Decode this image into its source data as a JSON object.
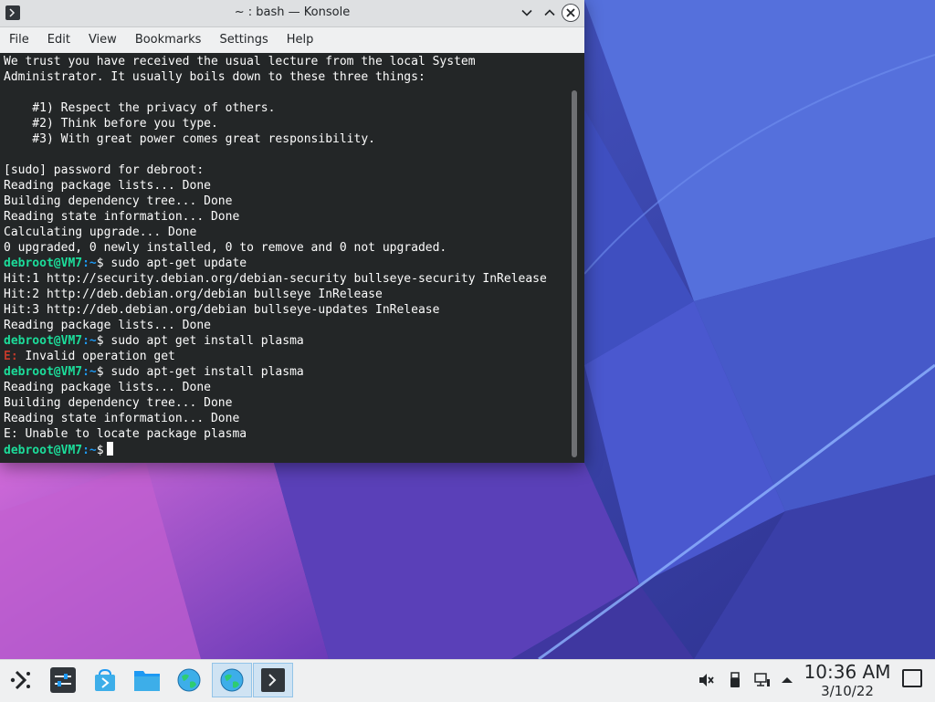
{
  "window": {
    "title": "~ : bash — Konsole",
    "menu": [
      "File",
      "Edit",
      "View",
      "Bookmarks",
      "Settings",
      "Help"
    ]
  },
  "terminal": {
    "lines": [
      {
        "type": "text",
        "text": "We trust you have received the usual lecture from the local System"
      },
      {
        "type": "text",
        "text": "Administrator. It usually boils down to these three things:"
      },
      {
        "type": "text",
        "text": ""
      },
      {
        "type": "text",
        "text": "    #1) Respect the privacy of others."
      },
      {
        "type": "text",
        "text": "    #2) Think before you type."
      },
      {
        "type": "text",
        "text": "    #3) With great power comes great responsibility."
      },
      {
        "type": "text",
        "text": ""
      },
      {
        "type": "text",
        "text": "[sudo] password for debroot:"
      },
      {
        "type": "text",
        "text": "Reading package lists... Done"
      },
      {
        "type": "text",
        "text": "Building dependency tree... Done"
      },
      {
        "type": "text",
        "text": "Reading state information... Done"
      },
      {
        "type": "text",
        "text": "Calculating upgrade... Done"
      },
      {
        "type": "text",
        "text": "0 upgraded, 0 newly installed, 0 to remove and 0 not upgraded."
      },
      {
        "type": "prompt",
        "user": "debroot@VM7",
        "sep": ":",
        "path": "~",
        "sign": "$",
        "command": " sudo apt-get update"
      },
      {
        "type": "text",
        "text": "Hit:1 http://security.debian.org/debian-security bullseye-security InRelease"
      },
      {
        "type": "text",
        "text": "Hit:2 http://deb.debian.org/debian bullseye InRelease"
      },
      {
        "type": "text",
        "text": "Hit:3 http://deb.debian.org/debian bullseye-updates InRelease"
      },
      {
        "type": "text",
        "text": "Reading package lists... Done"
      },
      {
        "type": "prompt",
        "user": "debroot@VM7",
        "sep": ":",
        "path": "~",
        "sign": "$",
        "command": " sudo apt get install plasma"
      },
      {
        "type": "error",
        "tag": "E:",
        "text": " Invalid operation get"
      },
      {
        "type": "prompt",
        "user": "debroot@VM7",
        "sep": ":",
        "path": "~",
        "sign": "$",
        "command": " sudo apt-get install plasma"
      },
      {
        "type": "text",
        "text": "Reading package lists... Done"
      },
      {
        "type": "text",
        "text": "Building dependency tree... Done"
      },
      {
        "type": "text",
        "text": "Reading state information... Done"
      },
      {
        "type": "text",
        "text": "E: Unable to locate package plasma"
      },
      {
        "type": "prompt",
        "user": "debroot@VM7",
        "sep": ":",
        "path": "~",
        "sign": "$",
        "command": "",
        "cursor": true
      }
    ]
  },
  "taskbar": {
    "apps": [
      {
        "name": "application-launcher",
        "icon": "kde-launcher-icon"
      },
      {
        "name": "system-settings",
        "icon": "settings-sliders-icon"
      },
      {
        "name": "discover",
        "icon": "discover-store-icon"
      },
      {
        "name": "dolphin",
        "icon": "folder-icon"
      },
      {
        "name": "web-browser-1",
        "icon": "globe-icon"
      },
      {
        "name": "web-browser-2",
        "icon": "globe-icon"
      },
      {
        "name": "konsole",
        "icon": "terminal-icon"
      }
    ],
    "tray": [
      "volume-muted-icon",
      "usb-device-icon",
      "network-icon",
      "expand-arrow-icon"
    ],
    "clock": {
      "time": "10:36 AM",
      "date": "3/10/22"
    }
  },
  "colors": {
    "terminal_bg": "#232627",
    "prompt_user": "#1cdc9a",
    "prompt_path": "#1d99f3",
    "error": "#c0392b",
    "panel_bg": "#eff0f1"
  }
}
